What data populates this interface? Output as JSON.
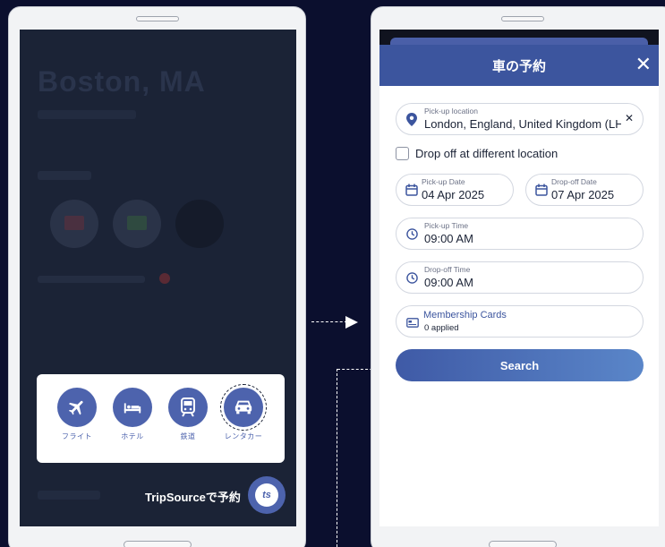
{
  "background": {
    "city": "Boston, MA"
  },
  "booking_bar": {
    "options": [
      {
        "label": "フライト",
        "icon": "plane-icon"
      },
      {
        "label": "ホテル",
        "icon": "bed-icon"
      },
      {
        "label": "鉄道",
        "icon": "train-icon"
      },
      {
        "label": "レンタカー",
        "icon": "car-icon",
        "selected": true
      }
    ],
    "tripsource_label": "TripSourceで予約",
    "logo_text": "ts"
  },
  "modal": {
    "title": "車の予約",
    "close": "✕",
    "pickup_location": {
      "label": "Pick-up location",
      "value": "London, England, United Kingdom (LH"
    },
    "dropoff_different": "Drop off at different location",
    "pickup_date": {
      "label": "Pick-up Date",
      "value": "04 Apr 2025"
    },
    "dropoff_date": {
      "label": "Drop-off Date",
      "value": "07 Apr 2025"
    },
    "pickup_time": {
      "label": "Pick-up Time",
      "value": "09:00 AM"
    },
    "dropoff_time": {
      "label": "Drop-off Time",
      "value": "09:00 AM"
    },
    "membership": {
      "label": "Membership Cards",
      "value": "0 applied"
    },
    "search_label": "Search"
  },
  "colors": {
    "brand": "#3c559e",
    "page_bg": "#0b0f2e"
  }
}
